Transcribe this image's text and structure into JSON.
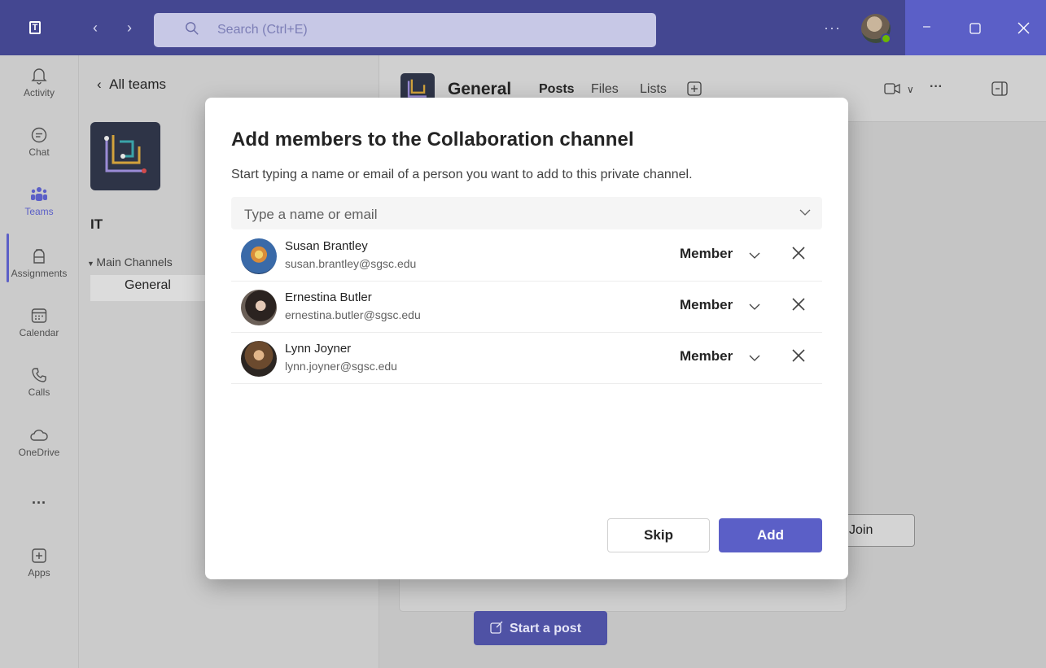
{
  "titlebar": {
    "search_placeholder": "Search (Ctrl+E)",
    "more": "···"
  },
  "rail": {
    "items": [
      {
        "label": "Activity",
        "icon": "bell-icon"
      },
      {
        "label": "Chat",
        "icon": "chat-icon"
      },
      {
        "label": "Teams",
        "icon": "teams-icon"
      },
      {
        "label": "Assignments",
        "icon": "backpack-icon"
      },
      {
        "label": "Calendar",
        "icon": "calendar-icon"
      },
      {
        "label": "Calls",
        "icon": "phone-icon"
      },
      {
        "label": "OneDrive",
        "icon": "cloud-icon"
      },
      {
        "label": "···",
        "icon": "more-icon"
      },
      {
        "label": "Apps",
        "icon": "apps-icon"
      }
    ],
    "accent_color": "#5b5fc7"
  },
  "teampanel": {
    "all_teams": "All teams",
    "team_name": "IT",
    "section": "Main Channels",
    "channel": "General"
  },
  "channel": {
    "title": "General",
    "tabs": [
      "Posts",
      "Files",
      "Lists"
    ],
    "join_label": "Join",
    "start_post_label": "Start a post"
  },
  "modal": {
    "title": "Add members to the Collaboration channel",
    "subtitle": "Start typing a name or email of a person you want to add to this private channel.",
    "input_placeholder": "Type a name or email",
    "members": [
      {
        "name": "Susan Brantley",
        "email": "susan.brantley@sgsc.edu",
        "role": "Member"
      },
      {
        "name": "Ernestina Butler",
        "email": "ernestina.butler@sgsc.edu",
        "role": "Member"
      },
      {
        "name": "Lynn Joyner",
        "email": "lynn.joyner@sgsc.edu",
        "role": "Member"
      }
    ],
    "skip_label": "Skip",
    "add_label": "Add"
  }
}
